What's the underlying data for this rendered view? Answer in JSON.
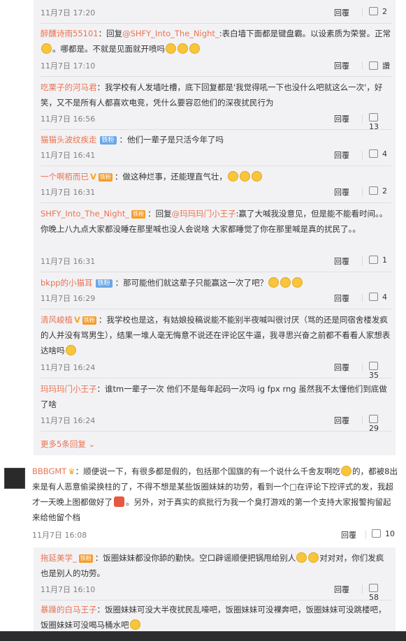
{
  "replies": [
    {
      "time": "11月7日 17:20",
      "reply_label": "回覆",
      "likes": "2"
    },
    {
      "user": "醉醺诗雨55101",
      "prefix": "：回复",
      "mention": "@SHFY_Into_The_Night_",
      "text": ":表白墙下面都是键盘霸。以设素质为荣誉。正常",
      "text2": "。哪都是。不就是见面就开喷吗",
      "time": "11月7日 17:10",
      "reply_label": "回覆",
      "likes": "讚"
    },
    {
      "user": "吃栗子的河马君",
      "text": "：我学校有人发墙吐槽，底下回复都是'我觉得吼一下也没什么吧就这么一次'，好笑，又不是所有人都喜欢电竞，凭什么要容忍他们的深夜扰民行为",
      "time": "11月7日 16:56",
      "reply_label": "回覆",
      "likes": "13"
    },
    {
      "user": "猫猫头波纹疾走",
      "badge": "铁粉",
      "text": "：他们一辈子是只活今年了吗",
      "time": "11月7日 16:41",
      "reply_label": "回覆",
      "likes": "4"
    },
    {
      "user": "一个啊栢而已",
      "badge": "铁粉",
      "text": "：做这种烂事，还能理直气壮，",
      "time": "11月7日 16:31",
      "reply_label": "回覆",
      "likes": "2"
    },
    {
      "user": "SHFY_Into_The_Night_",
      "badge": "铁粉",
      "prefix": "：回复",
      "mention": "@玛玛玛门小王子",
      "text": ":赢了大喊我没意见，但是能不能看时间。。你晚上八九点大家都没睡在那里喊也没人会说啥 大家都睡觉了你在那里喊是真的扰民了。。",
      "time": "11月7日 16:31",
      "reply_label": "回覆",
      "likes": "1"
    },
    {
      "user": "bkpp的小猫耳",
      "badge": "铁粉",
      "text": "：那可能他们就这辈子只能赢这一次了吧？",
      "time": "11月7日 16:29",
      "reply_label": "回覆",
      "likes": "4"
    },
    {
      "user": "清风峻植",
      "badge": "铁粉",
      "text": "：我学校也是这，有姑娘投稿说能不能别半夜喊叫很讨厌（骂的还是同宿舍楼发疯的人并没有骂男生），结果一堆人毫无悔意不说还在评论区牛逼，我寻思兴奋之前都不看看人家想表达啥吗",
      "time": "11月7日 16:24",
      "reply_label": "回覆",
      "likes": "35"
    },
    {
      "user": "玛玛玛门小王子",
      "text": "：谁tm一辈子一次 他们不是每年起码一次吗 ig fpx rng 虽然我不太懂他们到底做了啥",
      "time": "11月7日 16:24",
      "reply_label": "回覆",
      "likes": "29"
    }
  ],
  "more_label": "更多5条回复",
  "main": {
    "user": "BBBGMT",
    "text": "：顺便说一下，有很多都是假的，包括那个国旗的有一个说什么千舍友啊吃",
    "text2": "的，都被8出来是有人恶意偷梁换柱的了，不得不想是某些饭圈妹妹的功劳，看到一个□在评论下控评式的发，我超才一天晚上图都做好了",
    "text3": "。另外，对于真实的疯批行为我一个臭打游戏的第一个支持大家报警拘留起来给他留个档",
    "time": "11月7日 16:08",
    "reply_label": "回覆",
    "likes": "10"
  },
  "sub_replies": [
    {
      "user": "拖延美学_",
      "badge": "铁粉",
      "text": "：饭圈妹妹都没你舔的勤快。空口辟谣顺便把锅甩给别人",
      "text2": "对对对，你们发疯也是别人的功劳。",
      "time": "11月7日 16:10",
      "reply_label": "回覆",
      "likes": "58"
    },
    {
      "user": "暴躁的白马王子",
      "text": "：饭圈妹妹可没大半夜扰民乱嚎吧，饭圈妹妹可没裸奔吧，饭圈妹妹可没跳楼吧，饭圈妹妹可没喝马桶水吧"
    }
  ]
}
